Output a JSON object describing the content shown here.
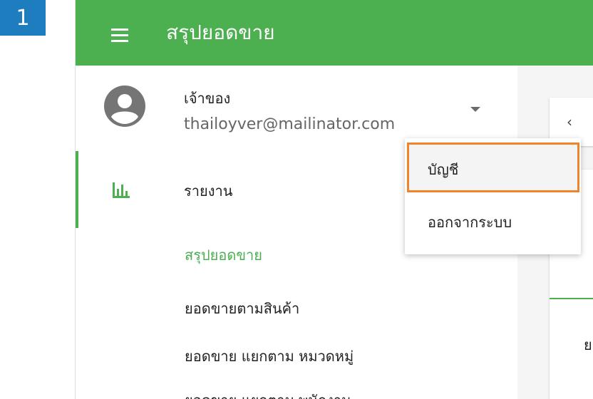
{
  "step_badge": "1",
  "header": {
    "title": "สรุปยอดขาย",
    "menu_icon": "hamburger-menu-icon"
  },
  "user": {
    "role": "เจ้าของ",
    "email": "thailoyver@mailinator.com",
    "avatar_icon": "account-circle-icon",
    "dropdown_icon": "caret-down-icon"
  },
  "sidebar": {
    "section_label": "รายงาน",
    "section_icon": "bar-chart-icon",
    "items": [
      {
        "label": "สรุปยอดขาย",
        "active": true
      },
      {
        "label": "ยอดขายตามสินค้า",
        "active": false
      },
      {
        "label": "ยอดขาย แยกตาม หมวดหมู่",
        "active": false
      },
      {
        "label": "ยอดขาย แยกตาม พนักงาน",
        "active": false
      }
    ]
  },
  "content": {
    "back_symbol": "‹",
    "cut_text": "ย"
  },
  "dropdown_menu": {
    "items": [
      {
        "label": "บัญชี",
        "highlighted": true
      },
      {
        "label": "ออกจากระบบ",
        "highlighted": false
      }
    ]
  },
  "colors": {
    "primary": "#4caf50",
    "highlight_border": "#f0842c",
    "badge": "#1e7dbf"
  }
}
